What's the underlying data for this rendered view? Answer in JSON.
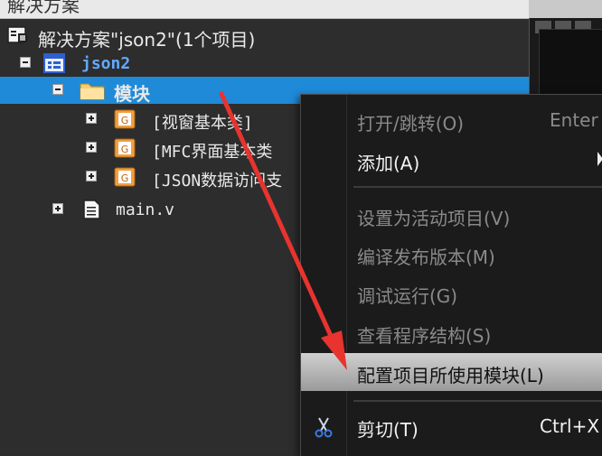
{
  "window": {
    "title_partial": "解决方案"
  },
  "tree": {
    "solution_label": "解决方案\"json2\"(1个项目)",
    "project_label": "json2",
    "module_folder_label": "模块",
    "modules": [
      {
        "label": "[视窗基本类]"
      },
      {
        "label": "[MFC界面基本类"
      },
      {
        "label": "[JSON数据访问支"
      }
    ],
    "file_label": "main.v"
  },
  "context_menu": {
    "items": [
      {
        "label": "打开/跳转(O)",
        "shortcut": "Enter",
        "disabled": true
      },
      {
        "label": "添加(A)",
        "has_submenu": true
      },
      {
        "label": "设置为活动项目(V)",
        "disabled": true
      },
      {
        "label": "编译发布版本(M)",
        "disabled": true
      },
      {
        "label": "调试运行(G)",
        "disabled": true
      },
      {
        "label": "查看程序结构(S)",
        "disabled": true
      },
      {
        "label": "配置项目所使用模块(L)",
        "highlighted": true
      },
      {
        "label": "剪切(T)",
        "shortcut": "Ctrl+X",
        "icon": "scissors-icon"
      }
    ]
  },
  "colors": {
    "panel_bg": "#2d2d2d",
    "selection": "#1f8ad8",
    "menu_bg": "#1b1b1b",
    "annotation_arrow": "#e8332f"
  }
}
